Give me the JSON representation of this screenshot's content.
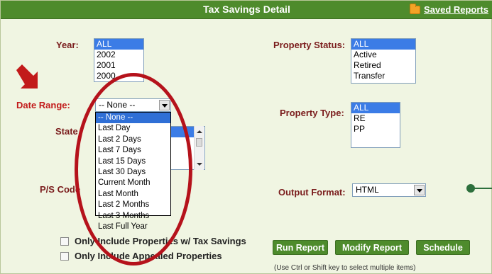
{
  "header": {
    "title": "Tax Savings Detail",
    "saved_reports": "Saved Reports"
  },
  "year": {
    "label": "Year:",
    "options": [
      "ALL",
      "2002",
      "2001",
      "2000"
    ],
    "selected": "ALL"
  },
  "date_range": {
    "label": "Date Range:",
    "value": "-- None --",
    "options": [
      "-- None --",
      "Last Day",
      "Last 2 Days",
      "Last 7 Days",
      "Last 15 Days",
      "Last 30 Days",
      "Current Month",
      "Last Month",
      "Last 2 Months",
      "Last 3 Months",
      "Last Full Year"
    ]
  },
  "state": {
    "label": "State"
  },
  "ps_code": {
    "label": "P/S Code"
  },
  "property_status": {
    "label": "Property Status:",
    "options": [
      "ALL",
      "Active",
      "Retired",
      "Transfer"
    ],
    "selected": "ALL"
  },
  "property_type": {
    "label": "Property Type:",
    "options": [
      "ALL",
      "RE",
      "PP"
    ],
    "selected": "ALL"
  },
  "output_format": {
    "label": "Output Format:",
    "value": "HTML"
  },
  "checkboxes": {
    "tax_savings": "Only Include Properties w/ Tax Savings",
    "appealed": "Only Include Appealed Properties"
  },
  "buttons": {
    "run": "Run Report",
    "modify": "Modify Report",
    "schedule": "Schedule"
  },
  "hint": "(Use Ctrl or Shift key to select multiple items)",
  "colors": {
    "header_green": "#4e8b2c",
    "label_maroon": "#7a1c1c",
    "highlight_red": "#b5121b",
    "selection_blue": "#3b7ce6"
  }
}
